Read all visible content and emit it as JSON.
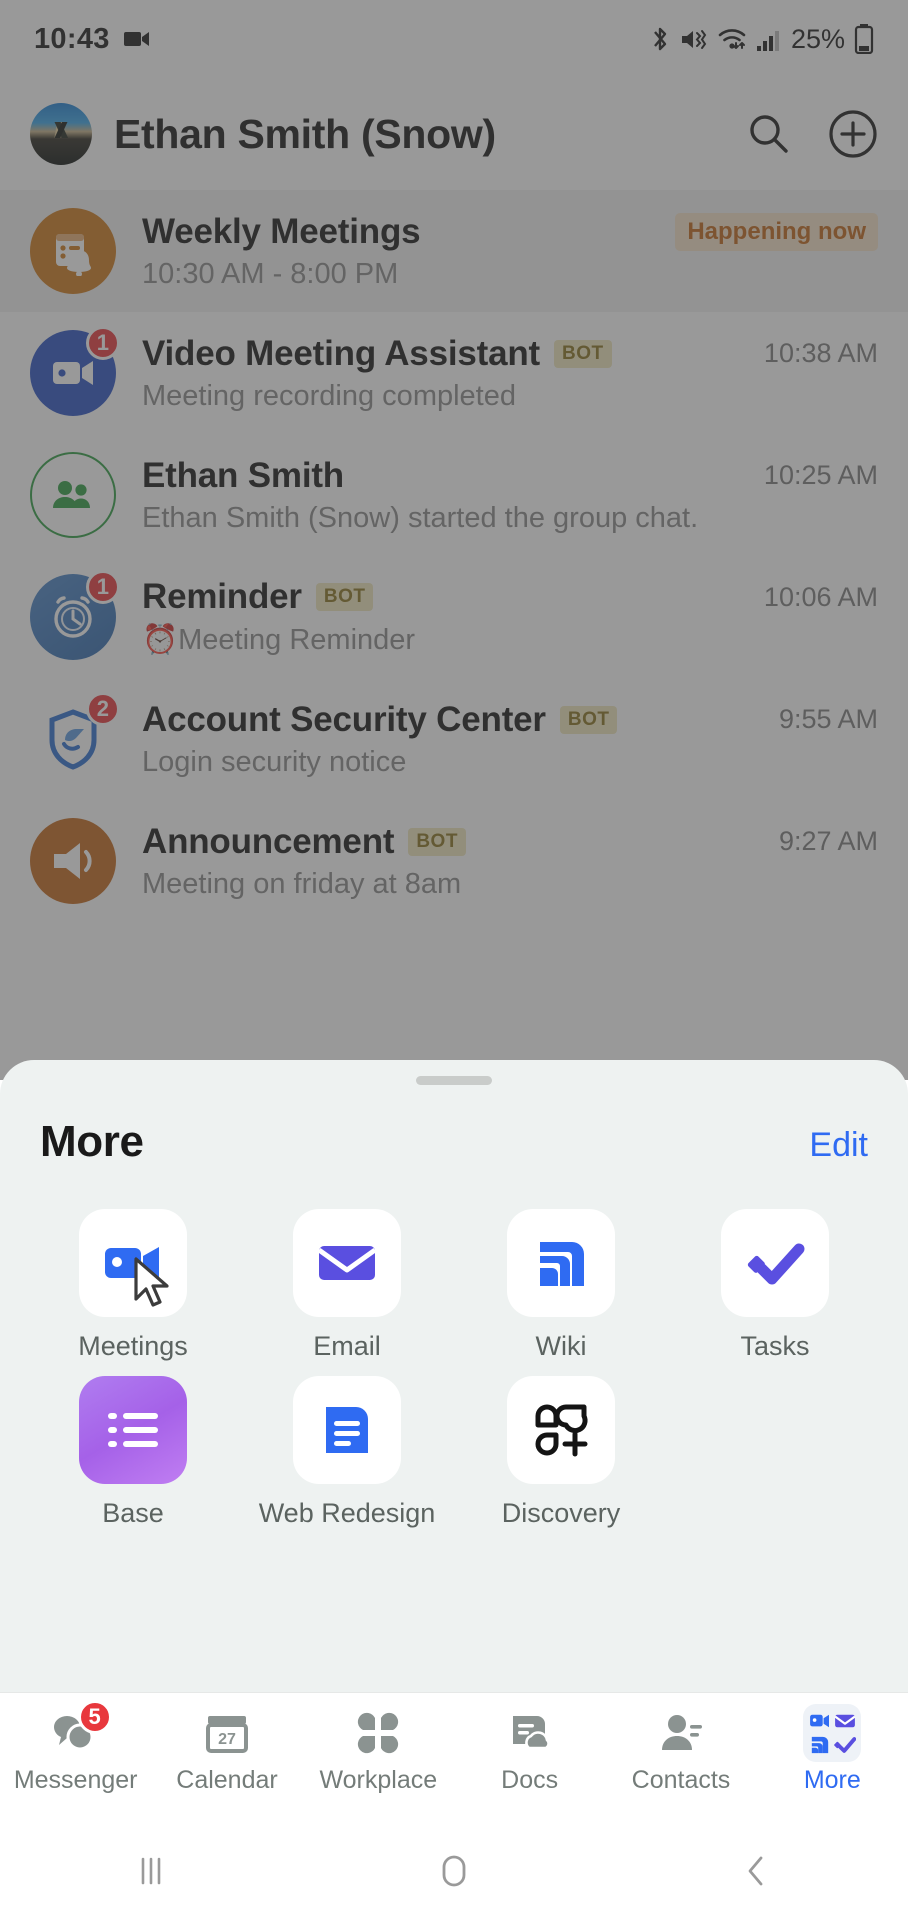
{
  "status_bar": {
    "time": "10:43",
    "battery_percent": "25%",
    "icons": [
      "video-recording-icon",
      "bluetooth-icon",
      "mute-vibrate-icon",
      "wifi-icon",
      "cellular-signal-icon",
      "battery-icon"
    ]
  },
  "header": {
    "title": "Ethan Smith (Snow)",
    "avatar": "user-avatar-photo",
    "search_icon": "search-icon",
    "add_icon": "add-circle-icon"
  },
  "chats": [
    {
      "name": "Weekly Meetings",
      "subtitle": "10:30 AM - 8:00 PM",
      "badge_text": "Happening now",
      "time": "",
      "bot": false,
      "unread": "",
      "avatar_icon": "calendar-bell-icon",
      "avatar_color": "#cf7a1d",
      "is_banner": true
    },
    {
      "name": "Video Meeting Assistant",
      "subtitle": "Meeting recording completed",
      "time": "10:38 AM",
      "bot": true,
      "bot_label": "BOT",
      "unread": "1",
      "avatar_icon": "video-camera-icon",
      "avatar_color": "#2b53c4",
      "is_banner": false
    },
    {
      "name": "Ethan Smith",
      "subtitle": "Ethan Smith (Snow) started the group chat.",
      "time": "10:25 AM",
      "bot": false,
      "unread": "",
      "avatar_icon": "group-people-icon",
      "avatar_color": "#ffffff",
      "is_banner": false
    },
    {
      "name": "Reminder",
      "subtitle": "⏰Meeting Reminder",
      "time": "10:06 AM",
      "bot": true,
      "bot_label": "BOT",
      "unread": "1",
      "avatar_icon": "alarm-clock-icon",
      "avatar_color": "#3d79bd",
      "is_banner": false
    },
    {
      "name": "Account Security Center",
      "subtitle": "Login security notice",
      "time": "9:55 AM",
      "bot": true,
      "bot_label": "BOT",
      "unread": "2",
      "avatar_icon": "shield-icon",
      "avatar_color": "#ffffff",
      "is_banner": false
    },
    {
      "name": "Announcement",
      "subtitle": "Meeting on friday at 8am",
      "time": "9:27 AM",
      "bot": true,
      "bot_label": "BOT",
      "unread": "",
      "avatar_icon": "megaphone-icon",
      "avatar_color": "#c4681d",
      "is_banner": false
    }
  ],
  "sheet": {
    "title": "More",
    "edit_label": "Edit",
    "apps": [
      {
        "label": "Meetings",
        "icon": "video-camera-icon",
        "has_cursor": true
      },
      {
        "label": "Email",
        "icon": "envelope-icon",
        "has_cursor": false
      },
      {
        "label": "Wiki",
        "icon": "wiki-icon",
        "has_cursor": false
      },
      {
        "label": "Tasks",
        "icon": "double-check-icon",
        "has_cursor": false
      },
      {
        "label": "Base",
        "icon": "list-grid-icon",
        "has_cursor": false
      },
      {
        "label": "Web Redesign",
        "icon": "document-icon",
        "has_cursor": false
      },
      {
        "label": "Discovery",
        "icon": "app-grid-plus-icon",
        "has_cursor": false
      }
    ]
  },
  "tabbar": {
    "tabs": [
      {
        "label": "Messenger",
        "icon": "chat-bubbles-icon",
        "badge": "5",
        "active": false
      },
      {
        "label": "Calendar",
        "icon": "calendar-icon",
        "day": "27",
        "badge": "",
        "active": false
      },
      {
        "label": "Workplace",
        "icon": "four-petal-icon",
        "badge": "",
        "active": false
      },
      {
        "label": "Docs",
        "icon": "docs-cloud-icon",
        "badge": "",
        "active": false
      },
      {
        "label": "Contacts",
        "icon": "contacts-icon",
        "badge": "",
        "active": false
      },
      {
        "label": "More",
        "icon": "more-grid-icon",
        "badge": "",
        "active": true
      }
    ]
  },
  "android_nav": {
    "recents": "recents-icon",
    "home": "home-icon",
    "back": "back-icon"
  },
  "colors": {
    "accent_blue": "#2f6bf2",
    "badge_red": "#e8383d",
    "bot_tag_bg": "#f0e7bd",
    "happening_text": "#c2661a",
    "sheet_bg": "#eef2f1"
  }
}
